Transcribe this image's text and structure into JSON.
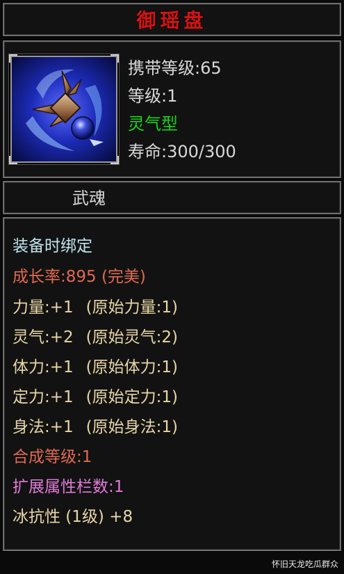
{
  "item": {
    "name": "御瑶盘",
    "carry_level": "携带等级:65",
    "level": "等级:1",
    "type": "灵气型",
    "life": "寿命:300/300",
    "icon": "spinning-disc-weapon-icon"
  },
  "soul": {
    "label": "武魂"
  },
  "attributes": {
    "bind": "装备时绑定",
    "growth": "成长率:895 (完美)",
    "stats": [
      {
        "main": "力量:+1",
        "orig": "(原始力量:1)"
      },
      {
        "main": "灵气:+2",
        "orig": "(原始灵气:2)"
      },
      {
        "main": "体力:+1",
        "orig": "(原始体力:1)"
      },
      {
        "main": "定力:+1",
        "orig": "(原始定力:1)"
      },
      {
        "main": "身法:+1",
        "orig": "(原始身法:1)"
      }
    ],
    "synth_level": "合成等级:1",
    "ext_slots": "扩展属性栏数:1",
    "ice_resist": "冰抗性 (1级) +8"
  },
  "watermark": "怀旧天龙吃瓜群众",
  "colors": {
    "title": "#d21414",
    "type_green": "#19d419",
    "bind": "#bfe4ee",
    "growth": "#e06a50",
    "stat": "#e8d6a6",
    "ext": "#e07ad8"
  }
}
